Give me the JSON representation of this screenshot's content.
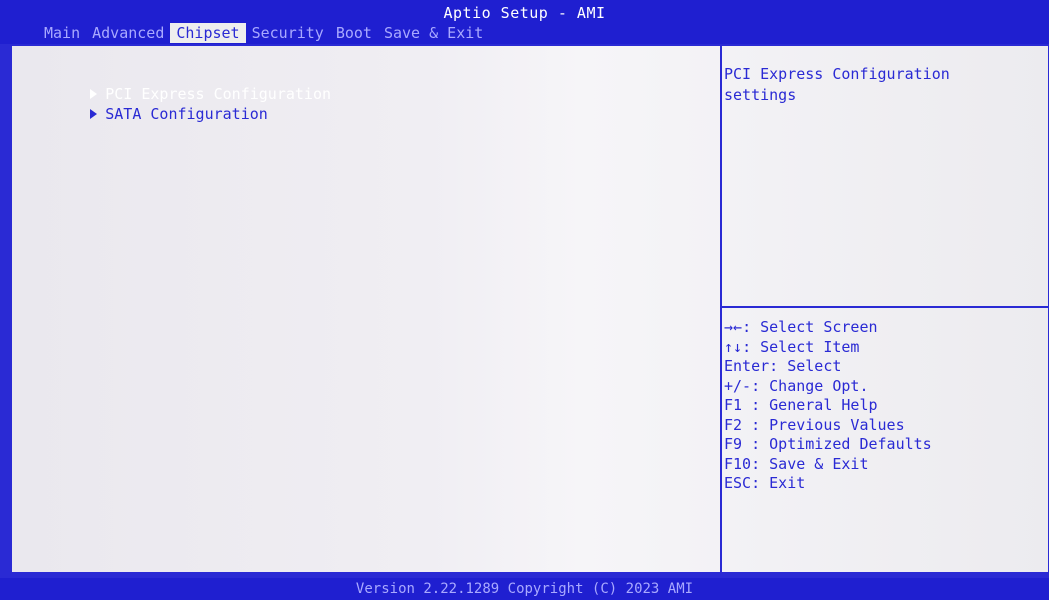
{
  "app": {
    "title": "Aptio Setup - AMI"
  },
  "tabs": [
    {
      "label": "Main"
    },
    {
      "label": "Advanced"
    },
    {
      "label": "Chipset"
    },
    {
      "label": "Security"
    },
    {
      "label": "Boot"
    },
    {
      "label": "Save & Exit"
    }
  ],
  "active_tab": "Chipset",
  "menu": {
    "items": [
      {
        "label": "PCI Express Configuration"
      },
      {
        "label": "SATA Configuration"
      }
    ],
    "selected": "PCI Express Configuration"
  },
  "help": {
    "line1": "PCI Express Configuration",
    "line2": "settings"
  },
  "hotkeys": [
    {
      "key": "→←",
      "desc": "Select Screen"
    },
    {
      "key": "↑↓",
      "desc": "Select Item"
    },
    {
      "key": "Enter",
      "desc": "Select"
    },
    {
      "key": "+/-",
      "desc": "Change Opt."
    },
    {
      "key": "F1 ",
      "desc": "General Help"
    },
    {
      "key": "F2 ",
      "desc": "Previous Values"
    },
    {
      "key": "F9 ",
      "desc": "Optimized Defaults"
    },
    {
      "key": "F10",
      "desc": "Save & Exit"
    },
    {
      "key": "ESC",
      "desc": "Exit"
    }
  ],
  "footer": {
    "text": "Version 2.22.1289 Copyright (C) 2023 AMI"
  },
  "colors": {
    "bios_blue": "#2a2ad4",
    "panel_background": "#eeeeee",
    "inactive_tab_text": "#a9a9ff",
    "highlight_text": "#ffffff"
  }
}
